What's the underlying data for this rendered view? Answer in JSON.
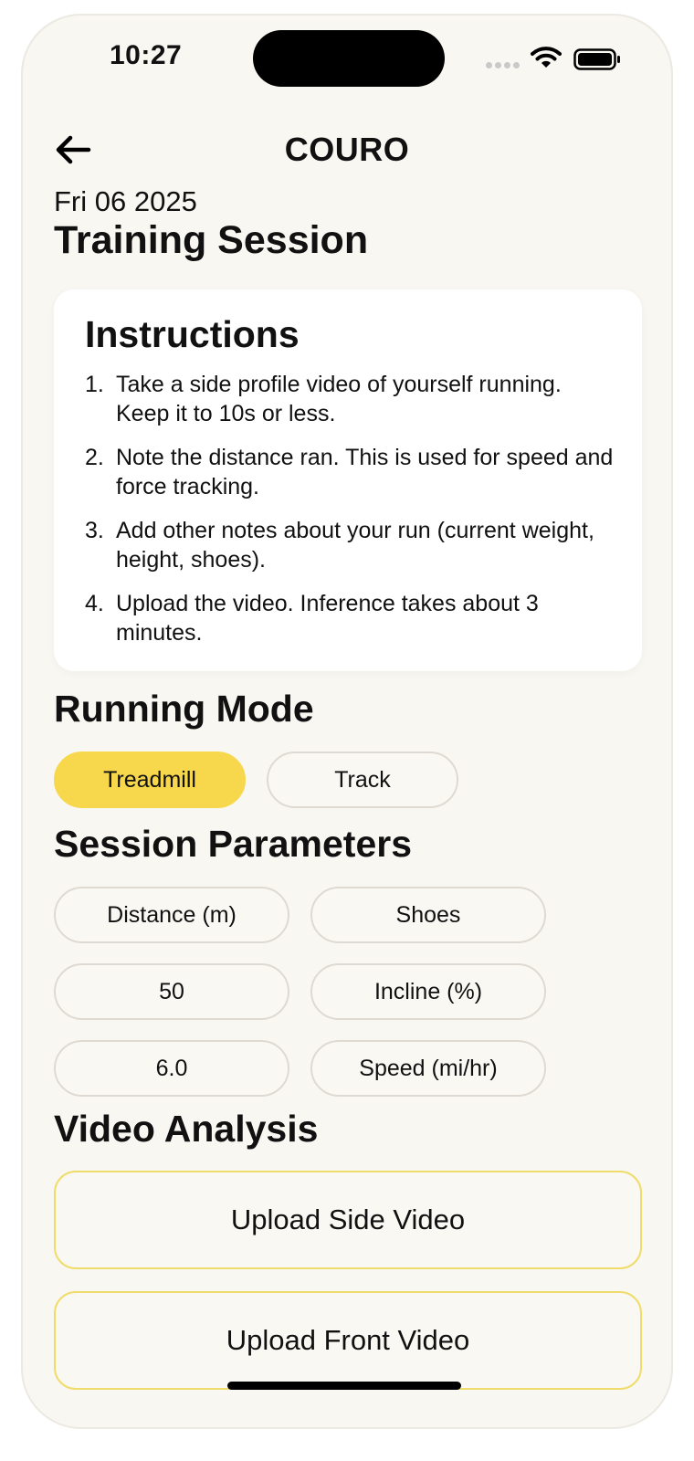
{
  "status_bar": {
    "time": "10:27"
  },
  "header": {
    "app_title": "COURO"
  },
  "session": {
    "date": "Fri 06 2025",
    "title": "Training Session"
  },
  "instructions": {
    "heading": "Instructions",
    "items": [
      {
        "num": "1.",
        "text": "Take a side profile video of yourself running. Keep it to 10s or less."
      },
      {
        "num": "2.",
        "text": "Note the distance ran. This is used for speed and force tracking."
      },
      {
        "num": "3.",
        "text": "Add other notes about your run (current weight, height, shoes)."
      },
      {
        "num": "4.",
        "text": "Upload the video. Inference takes about 3 minutes."
      }
    ]
  },
  "running_mode": {
    "heading": "Running Mode",
    "options": [
      "Treadmill",
      "Track"
    ],
    "selected": "Treadmill"
  },
  "session_parameters": {
    "heading": "Session Parameters",
    "distance_placeholder": "Distance (m)",
    "shoes_placeholder": "Shoes",
    "distance_value": "50",
    "incline_placeholder": "Incline (%)",
    "speed_value": "6.0",
    "speed_placeholder": "Speed (mi/hr)"
  },
  "video_analysis": {
    "heading": "Video Analysis",
    "upload_side_label": "Upload Side Video",
    "upload_front_label": "Upload Front Video"
  },
  "colors": {
    "background": "#f9f7f2",
    "accent": "#f7d84c",
    "upload_border": "#f0dc6a",
    "card": "#ffffff"
  }
}
